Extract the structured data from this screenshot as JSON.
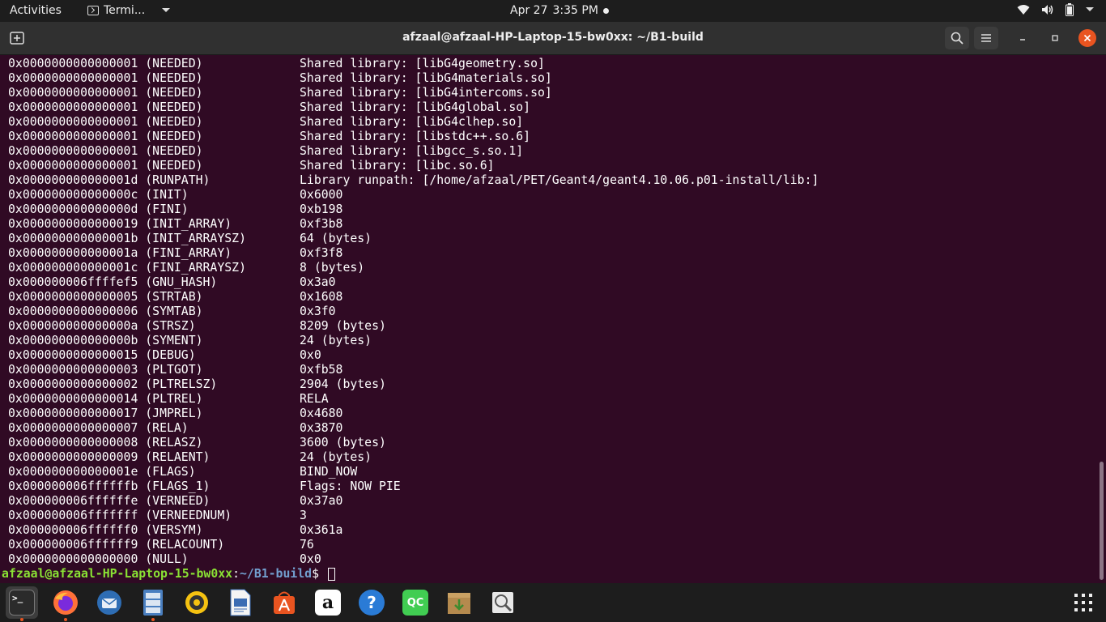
{
  "topbar": {
    "activities": "Activities",
    "app_name": "Termi...",
    "date": "Apr 27",
    "time": "3:35 PM"
  },
  "window": {
    "title": "afzaal@afzaal-HP-Laptop-15-bw0xx: ~/B1-build"
  },
  "terminal": {
    "lines": [
      {
        "addr": "0x0000000000000001 (NEEDED)",
        "value": "Shared library: [libG4geometry.so]"
      },
      {
        "addr": "0x0000000000000001 (NEEDED)",
        "value": "Shared library: [libG4materials.so]"
      },
      {
        "addr": "0x0000000000000001 (NEEDED)",
        "value": "Shared library: [libG4intercoms.so]"
      },
      {
        "addr": "0x0000000000000001 (NEEDED)",
        "value": "Shared library: [libG4global.so]"
      },
      {
        "addr": "0x0000000000000001 (NEEDED)",
        "value": "Shared library: [libG4clhep.so]"
      },
      {
        "addr": "0x0000000000000001 (NEEDED)",
        "value": "Shared library: [libstdc++.so.6]"
      },
      {
        "addr": "0x0000000000000001 (NEEDED)",
        "value": "Shared library: [libgcc_s.so.1]"
      },
      {
        "addr": "0x0000000000000001 (NEEDED)",
        "value": "Shared library: [libc.so.6]"
      },
      {
        "addr": "0x000000000000001d (RUNPATH)",
        "value": "Library runpath: [/home/afzaal/PET/Geant4/geant4.10.06.p01-install/lib:]"
      },
      {
        "addr": "0x000000000000000c (INIT)",
        "value": "0x6000"
      },
      {
        "addr": "0x000000000000000d (FINI)",
        "value": "0xb198"
      },
      {
        "addr": "0x0000000000000019 (INIT_ARRAY)",
        "value": "0xf3b8"
      },
      {
        "addr": "0x000000000000001b (INIT_ARRAYSZ)",
        "value": "64 (bytes)"
      },
      {
        "addr": "0x000000000000001a (FINI_ARRAY)",
        "value": "0xf3f8"
      },
      {
        "addr": "0x000000000000001c (FINI_ARRAYSZ)",
        "value": "8 (bytes)"
      },
      {
        "addr": "0x000000006ffffef5 (GNU_HASH)",
        "value": "0x3a0"
      },
      {
        "addr": "0x0000000000000005 (STRTAB)",
        "value": "0x1608"
      },
      {
        "addr": "0x0000000000000006 (SYMTAB)",
        "value": "0x3f0"
      },
      {
        "addr": "0x000000000000000a (STRSZ)",
        "value": "8209 (bytes)"
      },
      {
        "addr": "0x000000000000000b (SYMENT)",
        "value": "24 (bytes)"
      },
      {
        "addr": "0x0000000000000015 (DEBUG)",
        "value": "0x0"
      },
      {
        "addr": "0x0000000000000003 (PLTGOT)",
        "value": "0xfb58"
      },
      {
        "addr": "0x0000000000000002 (PLTRELSZ)",
        "value": "2904 (bytes)"
      },
      {
        "addr": "0x0000000000000014 (PLTREL)",
        "value": "RELA"
      },
      {
        "addr": "0x0000000000000017 (JMPREL)",
        "value": "0x4680"
      },
      {
        "addr": "0x0000000000000007 (RELA)",
        "value": "0x3870"
      },
      {
        "addr": "0x0000000000000008 (RELASZ)",
        "value": "3600 (bytes)"
      },
      {
        "addr": "0x0000000000000009 (RELAENT)",
        "value": "24 (bytes)"
      },
      {
        "addr": "0x000000000000001e (FLAGS)",
        "value": "BIND_NOW"
      },
      {
        "addr": "0x000000006ffffffb (FLAGS_1)",
        "value": "Flags: NOW PIE"
      },
      {
        "addr": "0x000000006ffffffe (VERNEED)",
        "value": "0x37a0"
      },
      {
        "addr": "0x000000006fffffff (VERNEEDNUM)",
        "value": "3"
      },
      {
        "addr": "0x000000006ffffff0 (VERSYM)",
        "value": "0x361a"
      },
      {
        "addr": "0x000000006ffffff9 (RELACOUNT)",
        "value": "76"
      },
      {
        "addr": "0x0000000000000000 (NULL)",
        "value": "0x0"
      }
    ],
    "prompt": {
      "user_host": "afzaal@afzaal-HP-Laptop-15-bw0xx",
      "colon": ":",
      "path": "~/B1-build",
      "symbol": "$ "
    }
  },
  "dock": {
    "items": [
      {
        "name": "terminal",
        "glyph": ">_"
      },
      {
        "name": "firefox",
        "glyph": ""
      },
      {
        "name": "thunderbird",
        "glyph": ""
      },
      {
        "name": "files",
        "glyph": ""
      },
      {
        "name": "rhythmbox",
        "glyph": ""
      },
      {
        "name": "libreoffice-writer",
        "glyph": ""
      },
      {
        "name": "ubuntu-software",
        "glyph": ""
      },
      {
        "name": "amazon",
        "glyph": "a"
      },
      {
        "name": "help",
        "glyph": "?"
      },
      {
        "name": "qt-creator",
        "glyph": "QC"
      },
      {
        "name": "archive-manager",
        "glyph": ""
      },
      {
        "name": "image-viewer",
        "glyph": ""
      }
    ]
  },
  "colors": {
    "terminal_bg": "#300a24",
    "prompt_user": "#8ae234",
    "prompt_path": "#729fcf",
    "close_button": "#e95420"
  }
}
